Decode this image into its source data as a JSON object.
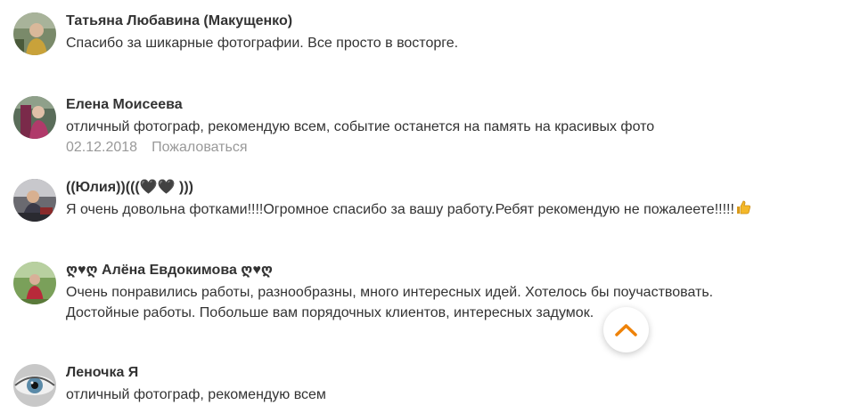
{
  "comments": [
    {
      "author": "Татьяна Любавина (Макущенко)",
      "text": "Спасибо за шикарные фотографии. Все просто в восторге.",
      "avatar_icon": "user-photo-avatar"
    },
    {
      "author": "Елена Моисеева",
      "text": "отличный фотограф, рекомендую всем, событие останется на память на красивых фото",
      "date": "02.12.2018",
      "report_label": "Пожаловаться",
      "avatar_icon": "user-photo-avatar"
    },
    {
      "author": "((Юлия))(((🖤🖤 )))",
      "text": "Я очень довольна фотками!!!!Огромное спасибо за вашу работу.Ребят рекомендую не пожалеете!!!!!",
      "emoji_icon": "thumbs-up-icon",
      "avatar_icon": "user-photo-avatar"
    },
    {
      "author": "ღ♥ღ Алёна Евдокимова ღ♥ღ",
      "text_lines": [
        "Очень понравились работы, разнообразны, много интересных идей. Хотелось бы поучаствовать.",
        "Достойные работы. Побольше вам порядочных клиентов, интересных задумок."
      ],
      "avatar_icon": "user-photo-avatar"
    },
    {
      "author": "Леночка Я",
      "text": "отличный фотограф, рекомендую всем",
      "avatar_icon": "eye-photo-avatar"
    }
  ],
  "colors": {
    "text": "#333333",
    "muted": "#999999",
    "accent": "#ee8208"
  },
  "scroll_button_icon": "chevron-up-icon"
}
